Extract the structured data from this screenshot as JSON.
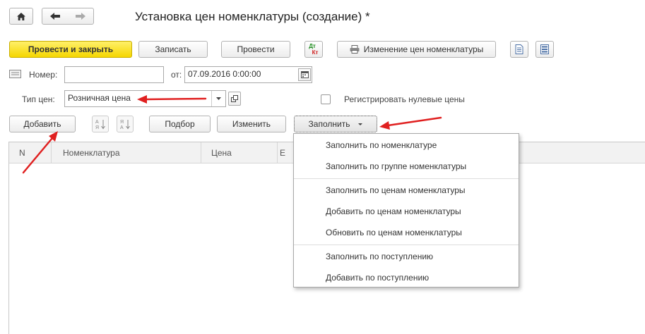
{
  "window": {
    "title": "Установка цен номенклатуры (создание) *"
  },
  "toolbar": {
    "post_close_label": "Провести и закрыть",
    "save_label": "Записать",
    "post_label": "Провести",
    "dtkt_top": "Дт",
    "dtkt_bottom": "Кт",
    "print_label": "Изменение цен номенклатуры"
  },
  "form": {
    "number_label": "Номер:",
    "number_value": "",
    "date_label": "от:",
    "date_value": "07.09.2016  0:00:00",
    "price_type_label": "Тип цен:",
    "price_type_value": "Розничная цена",
    "register_zero_label": "Регистрировать нулевые цены"
  },
  "table_toolbar": {
    "add_label": "Добавить",
    "pick_label": "Подбор",
    "change_label": "Изменить",
    "fill_label": "Заполнить"
  },
  "table": {
    "columns": [
      "N",
      "Номенклатура",
      "Цена",
      "Е"
    ]
  },
  "fill_menu": {
    "groups": [
      [
        "Заполнить по номенклатуре",
        "Заполнить по группе номенклатуры"
      ],
      [
        "Заполнить по ценам номенклатуры",
        "Добавить по ценам номенклатуры",
        "Обновить по ценам номенклатуры"
      ],
      [
        "Заполнить по поступлению",
        "Добавить по поступлению"
      ]
    ]
  },
  "colors": {
    "primary_button": "#f5d600",
    "annotation_arrow": "#e02020"
  }
}
